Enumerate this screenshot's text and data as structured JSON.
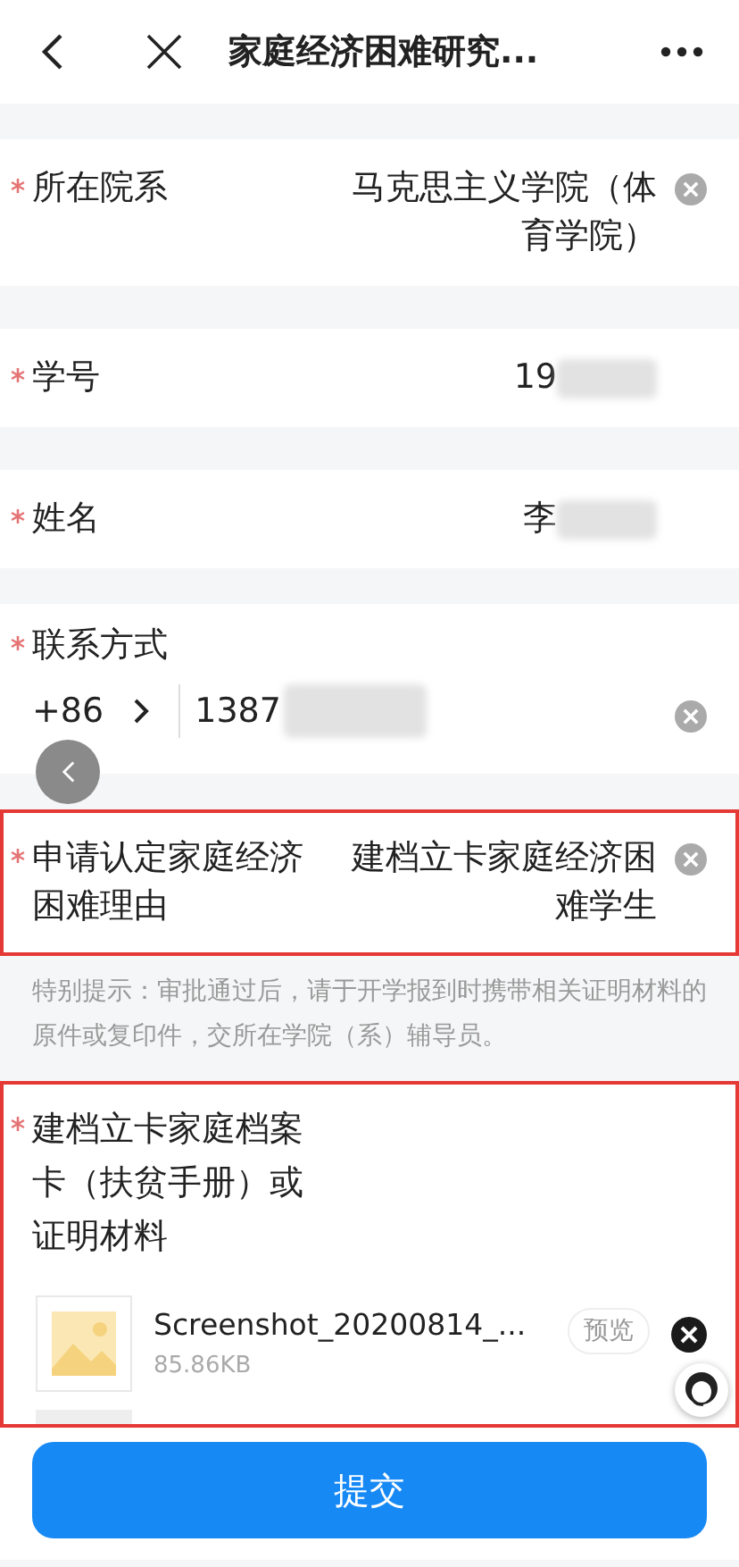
{
  "header": {
    "title": "家庭经济困难研究..."
  },
  "fields": [
    {
      "kind": "text",
      "required": true,
      "label": "所在院系",
      "value": "马克思主义学院（体育学院）",
      "clearable": true,
      "redacted": false,
      "highlighted": false
    },
    {
      "kind": "text",
      "required": true,
      "label": "学号",
      "value": "19",
      "clearable": false,
      "redacted": true,
      "highlighted": false
    },
    {
      "kind": "text",
      "required": true,
      "label": "姓名",
      "value": "李",
      "clearable": false,
      "redacted": true,
      "highlighted": false
    },
    {
      "kind": "phone",
      "required": true,
      "label": "联系方式",
      "prefix": "+86",
      "value": "1387",
      "clearable": true,
      "redacted": true,
      "highlighted": false
    },
    {
      "kind": "text",
      "required": true,
      "label": "申请认定家庭经济困难理由",
      "value": "建档立卡家庭经济困难学生",
      "clearable": true,
      "redacted": false,
      "highlighted": true
    },
    {
      "kind": "note",
      "text": "特别提示：审批通过后，请于开学报到时携带相关证明材料的原件或复印件，交所在学院（系）辅导员。"
    },
    {
      "kind": "upload",
      "required": true,
      "label": "建档立卡家庭档案卡（扶贫手册）或证明材料",
      "highlighted": true,
      "file": {
        "name": "Screenshot_20200814_...",
        "size": "85.86KB",
        "action": "预览"
      }
    }
  ],
  "submit": "提交"
}
